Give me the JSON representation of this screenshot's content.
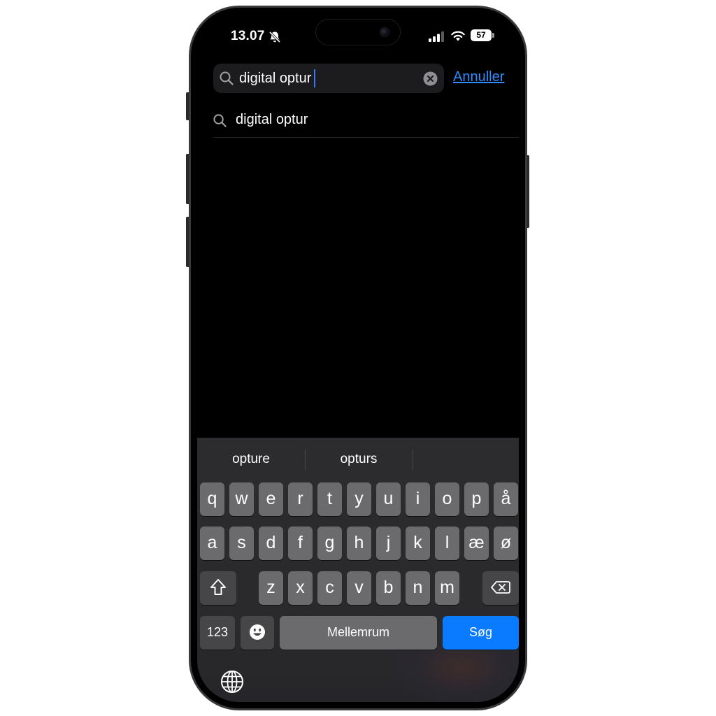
{
  "status_bar": {
    "time": "13.07",
    "battery": "57",
    "icons": [
      "bell-slash-icon",
      "signal-icon",
      "wifi-icon",
      "battery-icon"
    ]
  },
  "search": {
    "query": "digital optur",
    "clear_icon": "xmark-circle-icon",
    "cancel_label": "Annuller"
  },
  "suggestions": [
    {
      "text": "digital optur",
      "icon": "search-icon"
    }
  ],
  "keyboard": {
    "predictions": [
      "opture",
      "opturs",
      ""
    ],
    "row1": [
      "q",
      "w",
      "e",
      "r",
      "t",
      "y",
      "u",
      "i",
      "o",
      "p",
      "å"
    ],
    "row2": [
      "a",
      "s",
      "d",
      "f",
      "g",
      "h",
      "j",
      "k",
      "l",
      "æ",
      "ø"
    ],
    "row3": [
      "z",
      "x",
      "c",
      "v",
      "b",
      "n",
      "m"
    ],
    "numbers_label": "123",
    "space_label": "Mellemrum",
    "action_label": "Søg",
    "icons": [
      "shift-icon",
      "backspace-icon",
      "emoji-icon",
      "globe-icon"
    ]
  },
  "colors": {
    "accent": "#0a7aff",
    "link": "#2f8cff",
    "key": "#6b6b6d",
    "function_key": "#464648",
    "screen_bg": "#000000"
  }
}
